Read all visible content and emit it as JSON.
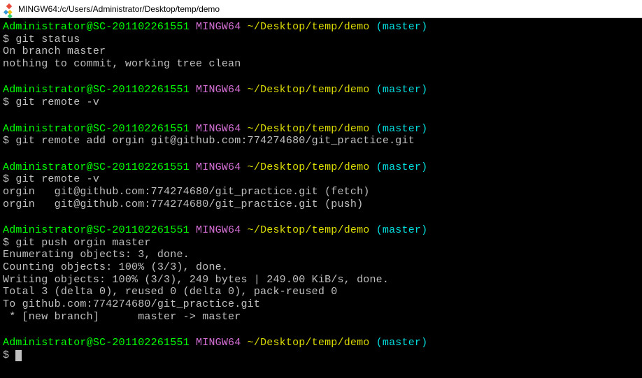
{
  "titlebar": {
    "text": "MINGW64:/c/Users/Administrator/Desktop/temp/demo"
  },
  "prompt": {
    "user_host": "Administrator@SC-201102261551",
    "env": "MINGW64",
    "path": "~/Desktop/temp/demo",
    "branch": "(master)",
    "symbol": "$"
  },
  "blocks": [
    {
      "command": "git status",
      "output": "On branch master\nnothing to commit, working tree clean"
    },
    {
      "command": "git remote -v",
      "output": ""
    },
    {
      "command": "git remote add orgin git@github.com:774274680/git_practice.git",
      "output": ""
    },
    {
      "command": "git remote -v",
      "output": "orgin   git@github.com:774274680/git_practice.git (fetch)\norgin   git@github.com:774274680/git_practice.git (push)"
    },
    {
      "command": "git push orgin master",
      "output": "Enumerating objects: 3, done.\nCounting objects: 100% (3/3), done.\nWriting objects: 100% (3/3), 249 bytes | 249.00 KiB/s, done.\nTotal 3 (delta 0), reused 0 (delta 0), pack-reused 0\nTo github.com:774274680/git_practice.git\n * [new branch]      master -> master"
    },
    {
      "command": "",
      "output": ""
    }
  ]
}
